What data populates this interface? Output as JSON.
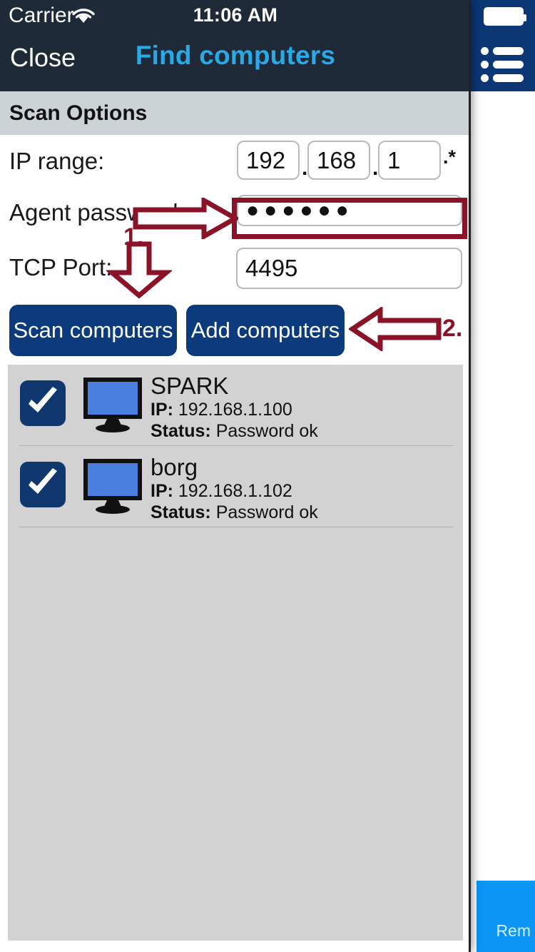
{
  "status_bar": {
    "carrier": "Carrier",
    "wifi_icon": "wifi-icon",
    "time": "11:06 AM",
    "battery_icon": "battery-full-icon"
  },
  "nav_bar": {
    "close_label": "Close",
    "title": "Find computers",
    "title_color": "#29a9e6",
    "background_color": "#1e2a38"
  },
  "right_panel": {
    "menu_icon": "list-menu-icon",
    "bottom_button_label": "Rem",
    "bottom_button_color": "#0b96f5",
    "nav_color": "#0b3775"
  },
  "section": {
    "header": "Scan Options"
  },
  "form": {
    "ip_range": {
      "label": "IP range:",
      "octet1": "192",
      "octet2": "168",
      "octet3": "1",
      "separator": ".",
      "wildcard": ".*"
    },
    "agent_password": {
      "label": "Agent password:",
      "value": "●●●●●●",
      "placeholder": "",
      "highlight_color": "#8a1328"
    },
    "tcp_port": {
      "label": "TCP Port:",
      "value": "4495",
      "placeholder": ""
    }
  },
  "buttons": {
    "scan": "Scan computers",
    "add": "Add computers",
    "color": "#0b3a7d"
  },
  "computers": [
    {
      "name": "SPARK",
      "ip_label": "IP:",
      "ip": "192.168.1.100",
      "status_label": "Status:",
      "status": "Password ok",
      "checked": true,
      "icon": "monitor-icon"
    },
    {
      "name": "borg",
      "ip_label": "IP:",
      "ip": "192.168.1.102",
      "status_label": "Status:",
      "status": "Password ok",
      "checked": true,
      "icon": "monitor-icon"
    }
  ],
  "annotations": {
    "color": "#8a1328",
    "step1": "1.",
    "step2": "2."
  }
}
